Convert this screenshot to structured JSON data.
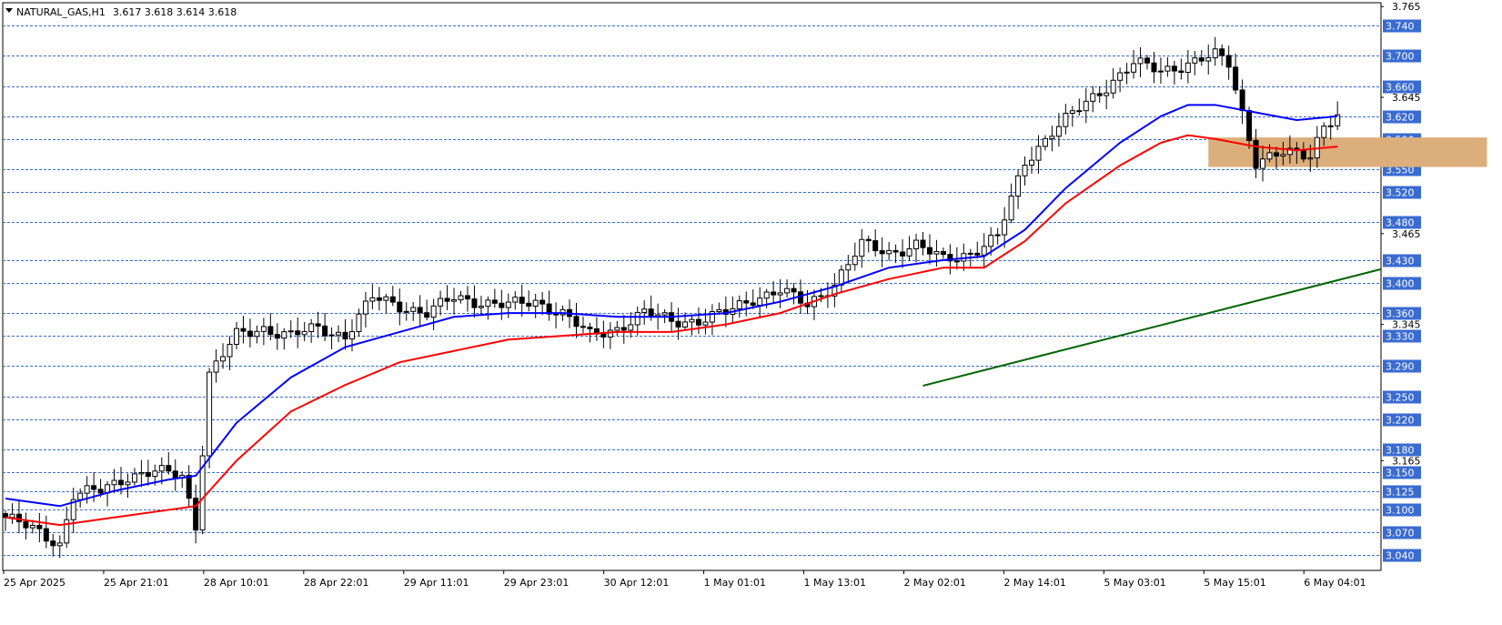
{
  "header": {
    "symbol_timeframe": "NATURAL_GAS,H1",
    "ohlc": "3.617 3.618 3.614 3.618"
  },
  "colors": {
    "bull_candle": "#ffffff",
    "bear_candle": "#000000",
    "ma_fast": "#0000ff",
    "ma_slow": "#ff0000",
    "trendline": "#006400",
    "zone_fill": "#dcae7b",
    "level_line": "#3a6bd1",
    "level_badge": "#3a6bd1"
  },
  "chart_data": {
    "type": "candlestick",
    "symbol": "NATURAL_GAS",
    "timeframe": "H1",
    "ylim": [
      3.02,
      3.77
    ],
    "x_tick_labels": [
      "25 Apr 2025",
      "25 Apr 21:01",
      "28 Apr 10:01",
      "28 Apr 22:01",
      "29 Apr 11:01",
      "29 Apr 23:01",
      "30 Apr 12:01",
      "1 May 01:01",
      "1 May 13:01",
      "2 May 02:01",
      "2 May 14:01",
      "5 May 03:01",
      "5 May 15:01",
      "6 May 04:01"
    ],
    "y_tick_labels": [
      "3.765",
      "3.645",
      "3.465",
      "3.345",
      "3.165"
    ],
    "levels": [
      "3.740",
      "3.700",
      "3.660",
      "3.620",
      "3.590",
      "3.550",
      "3.520",
      "3.480",
      "3.430",
      "3.400",
      "3.360",
      "3.330",
      "3.290",
      "3.250",
      "3.220",
      "3.180",
      "3.150",
      "3.125",
      "3.100",
      "3.070",
      "3.040"
    ],
    "close_anchors": [
      [
        0,
        3.09
      ],
      [
        5,
        3.07
      ],
      [
        8,
        3.055
      ],
      [
        10,
        3.12
      ],
      [
        14,
        3.125
      ],
      [
        18,
        3.145
      ],
      [
        22,
        3.15
      ],
      [
        26,
        3.145
      ],
      [
        28,
        3.08
      ],
      [
        30,
        3.28
      ],
      [
        34,
        3.33
      ],
      [
        38,
        3.34
      ],
      [
        42,
        3.33
      ],
      [
        46,
        3.34
      ],
      [
        50,
        3.33
      ],
      [
        54,
        3.38
      ],
      [
        58,
        3.37
      ],
      [
        62,
        3.36
      ],
      [
        66,
        3.38
      ],
      [
        70,
        3.375
      ],
      [
        74,
        3.37
      ],
      [
        78,
        3.375
      ],
      [
        82,
        3.36
      ],
      [
        86,
        3.33
      ],
      [
        90,
        3.34
      ],
      [
        94,
        3.36
      ],
      [
        98,
        3.35
      ],
      [
        102,
        3.35
      ],
      [
        106,
        3.36
      ],
      [
        110,
        3.38
      ],
      [
        114,
        3.39
      ],
      [
        118,
        3.37
      ],
      [
        122,
        3.4
      ],
      [
        126,
        3.45
      ],
      [
        130,
        3.44
      ],
      [
        134,
        3.45
      ],
      [
        138,
        3.43
      ],
      [
        142,
        3.44
      ],
      [
        146,
        3.46
      ],
      [
        150,
        3.56
      ],
      [
        154,
        3.6
      ],
      [
        158,
        3.63
      ],
      [
        162,
        3.66
      ],
      [
        166,
        3.69
      ],
      [
        170,
        3.68
      ],
      [
        174,
        3.69
      ],
      [
        178,
        3.7
      ],
      [
        180,
        3.69
      ],
      [
        184,
        3.56
      ],
      [
        188,
        3.57
      ],
      [
        192,
        3.57
      ],
      [
        194,
        3.61
      ],
      [
        196,
        3.62
      ]
    ],
    "moving_averages": [
      {
        "color_key": "ma_fast",
        "points": [
          [
            0,
            3.115
          ],
          [
            8,
            3.105
          ],
          [
            16,
            3.125
          ],
          [
            24,
            3.14
          ],
          [
            28,
            3.145
          ],
          [
            34,
            3.215
          ],
          [
            42,
            3.275
          ],
          [
            50,
            3.315
          ],
          [
            58,
            3.335
          ],
          [
            66,
            3.355
          ],
          [
            74,
            3.36
          ],
          [
            82,
            3.36
          ],
          [
            90,
            3.355
          ],
          [
            98,
            3.355
          ],
          [
            106,
            3.36
          ],
          [
            114,
            3.375
          ],
          [
            122,
            3.395
          ],
          [
            130,
            3.42
          ],
          [
            138,
            3.43
          ],
          [
            144,
            3.435
          ],
          [
            150,
            3.47
          ],
          [
            156,
            3.525
          ],
          [
            164,
            3.585
          ],
          [
            170,
            3.62
          ],
          [
            174,
            3.635
          ],
          [
            178,
            3.635
          ],
          [
            184,
            3.625
          ],
          [
            190,
            3.615
          ],
          [
            196,
            3.62
          ]
        ]
      },
      {
        "color_key": "ma_slow",
        "points": [
          [
            0,
            3.09
          ],
          [
            8,
            3.08
          ],
          [
            16,
            3.09
          ],
          [
            24,
            3.1
          ],
          [
            28,
            3.105
          ],
          [
            34,
            3.165
          ],
          [
            42,
            3.23
          ],
          [
            50,
            3.265
          ],
          [
            58,
            3.295
          ],
          [
            66,
            3.31
          ],
          [
            74,
            3.325
          ],
          [
            82,
            3.33
          ],
          [
            90,
            3.335
          ],
          [
            98,
            3.335
          ],
          [
            106,
            3.345
          ],
          [
            114,
            3.36
          ],
          [
            122,
            3.385
          ],
          [
            130,
            3.405
          ],
          [
            138,
            3.42
          ],
          [
            144,
            3.42
          ],
          [
            150,
            3.455
          ],
          [
            156,
            3.505
          ],
          [
            164,
            3.555
          ],
          [
            170,
            3.585
          ],
          [
            174,
            3.595
          ],
          [
            178,
            3.59
          ],
          [
            184,
            3.58
          ],
          [
            190,
            3.575
          ],
          [
            196,
            3.58
          ]
        ]
      }
    ],
    "trendline": {
      "from": [
        135,
        3.264
      ],
      "to": [
        325,
        3.698
      ]
    },
    "zone": {
      "from_bar": 177,
      "to_bar": 218,
      "low": 3.553,
      "high": 3.592
    },
    "grid": false
  }
}
